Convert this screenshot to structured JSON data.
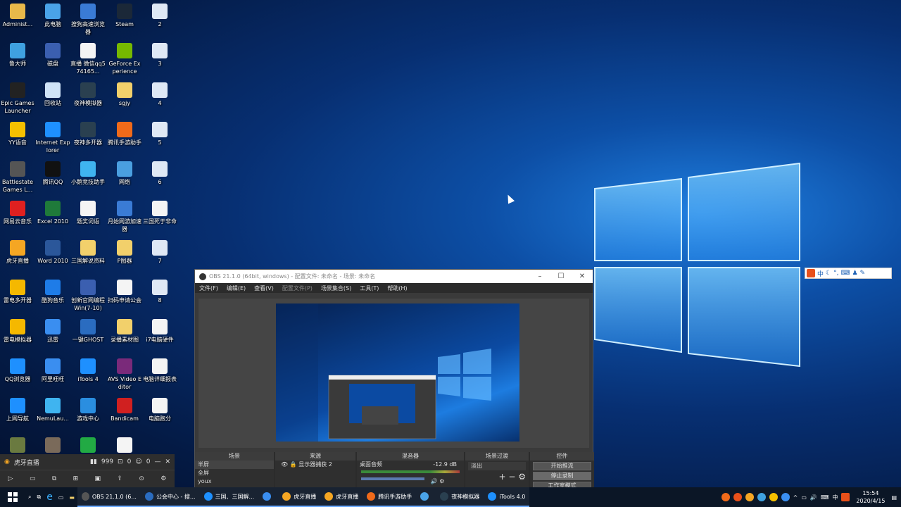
{
  "desktop_icons": [
    {
      "label": "Administ...",
      "icon": "user-folder-icon",
      "color": "#e8b84a"
    },
    {
      "label": "此电脑",
      "icon": "computer-icon",
      "color": "#4aa3e8"
    },
    {
      "label": "搜狗高速浏览器",
      "icon": "sogou-browser-icon",
      "color": "#3a7bd5"
    },
    {
      "label": "Steam",
      "icon": "steam-icon",
      "color": "#1b2838"
    },
    {
      "label": "2",
      "icon": "word-doc-icon",
      "color": "#dfe8f5"
    },
    {
      "label": "鲁大师",
      "icon": "ludashi-icon",
      "color": "#3fa1e0"
    },
    {
      "label": "磁盘",
      "icon": "disk-tool-icon",
      "color": "#3b5fb0"
    },
    {
      "label": "直播 微信qq574165...",
      "icon": "text-file-icon",
      "color": "#f4f4f4"
    },
    {
      "label": "GeForce Experience",
      "icon": "nvidia-icon",
      "color": "#76b900"
    },
    {
      "label": "3",
      "icon": "word-doc-icon",
      "color": "#dfe8f5"
    },
    {
      "label": "Epic Games Launcher",
      "icon": "epic-games-icon",
      "color": "#222222"
    },
    {
      "label": "回收站",
      "icon": "recycle-bin-icon",
      "color": "#cfe3f7"
    },
    {
      "label": "夜神模拟器",
      "icon": "nox-icon",
      "color": "#2a4050"
    },
    {
      "label": "sgjy",
      "icon": "folder-icon",
      "color": "#f2d06b"
    },
    {
      "label": "4",
      "icon": "word-doc-icon",
      "color": "#dfe8f5"
    },
    {
      "label": "YY语音",
      "icon": "yy-icon",
      "color": "#f5c000"
    },
    {
      "label": "Internet Explorer",
      "icon": "ie-icon",
      "color": "#1e90ff"
    },
    {
      "label": "夜神多开器",
      "icon": "nox-multi-icon",
      "color": "#2a4050"
    },
    {
      "label": "腾讯手游助手",
      "icon": "tencent-gamer-icon",
      "color": "#f06a1a"
    },
    {
      "label": "5",
      "icon": "word-doc-icon",
      "color": "#dfe8f5"
    },
    {
      "label": "Battlestate Games L...",
      "icon": "battlestate-icon",
      "color": "#555555"
    },
    {
      "label": "腾讯QQ",
      "icon": "qq-icon",
      "color": "#111111"
    },
    {
      "label": "小鹅竞技助手",
      "icon": "goose-icon",
      "color": "#3fb4f0"
    },
    {
      "label": "网络",
      "icon": "network-icon",
      "color": "#4a9fe0"
    },
    {
      "label": "6",
      "icon": "word-doc-icon",
      "color": "#dfe8f5"
    },
    {
      "label": "网易云音乐",
      "icon": "netease-music-icon",
      "color": "#e02020"
    },
    {
      "label": "Excel 2010",
      "icon": "excel-icon",
      "color": "#1f7a3a"
    },
    {
      "label": "题奖词语",
      "icon": "text-file-icon",
      "color": "#f4f4f4"
    },
    {
      "label": "月始网游加速器",
      "icon": "accelerator-icon",
      "color": "#3a7bd5"
    },
    {
      "label": "三国死于非命",
      "icon": "text-file-icon",
      "color": "#f4f4f4"
    },
    {
      "label": "虎牙直播",
      "icon": "huya-icon",
      "color": "#f5a623"
    },
    {
      "label": "Word 2010",
      "icon": "word-icon",
      "color": "#2b579a"
    },
    {
      "label": "三国解说资料",
      "icon": "folder-icon",
      "color": "#f2d06b"
    },
    {
      "label": "P图器",
      "icon": "folder-icon",
      "color": "#f2d06b"
    },
    {
      "label": "7",
      "icon": "word-doc-icon",
      "color": "#dfe8f5"
    },
    {
      "label": "雷电多开器",
      "icon": "ldplayer-multi-icon",
      "color": "#f5b800"
    },
    {
      "label": "酷狗音乐",
      "icon": "kugou-icon",
      "color": "#1e7ce8"
    },
    {
      "label": "创新官网编程Win(7-10)",
      "icon": "creative-icon",
      "color": "#3b5fb0"
    },
    {
      "label": "扫码申请公会",
      "icon": "text-file-icon",
      "color": "#f4f4f4"
    },
    {
      "label": "8",
      "icon": "word-doc-icon",
      "color": "#dfe8f5"
    },
    {
      "label": "雷电模拟器",
      "icon": "ldplayer-icon",
      "color": "#f5b800"
    },
    {
      "label": "迅雷",
      "icon": "xunlei-icon",
      "color": "#3a8ef0"
    },
    {
      "label": "一键GHOST",
      "icon": "ghost-icon",
      "color": "#2a6cc0"
    },
    {
      "label": "录播素材图",
      "icon": "folder-icon",
      "color": "#f2d06b"
    },
    {
      "label": "i7电脑硬件",
      "icon": "text-file-icon",
      "color": "#f4f4f4"
    },
    {
      "label": "QQ浏览器",
      "icon": "qq-browser-icon",
      "color": "#1e90ff"
    },
    {
      "label": "阿里旺旺",
      "icon": "wangwang-icon",
      "color": "#3a8ef0"
    },
    {
      "label": "iTools 4",
      "icon": "itools-icon",
      "color": "#1e90ff"
    },
    {
      "label": "AVS Video Editor",
      "icon": "avs-icon",
      "color": "#7a2a7a"
    },
    {
      "label": "电脑详细报表",
      "icon": "text-file-icon",
      "color": "#f4f4f4"
    },
    {
      "label": "上网导航",
      "icon": "ie-nav-icon",
      "color": "#1e90ff"
    },
    {
      "label": "NemuLau...",
      "icon": "mumu-icon",
      "color": "#3fb4f0"
    },
    {
      "label": "游戏中心",
      "icon": "game-center-icon",
      "color": "#2a8ee0"
    },
    {
      "label": "Bandicam",
      "icon": "bandicam-icon",
      "color": "#d02020"
    },
    {
      "label": "电脑跑分",
      "icon": "text-file-icon",
      "color": "#f4f4f4"
    },
    {
      "label": "",
      "icon": "game-icon",
      "color": "#6a7a40"
    },
    {
      "label": "dwrg (3)",
      "icon": "game-icon",
      "color": "#7a6a5a"
    },
    {
      "label": "迅雷影音...",
      "icon": "green-ball-icon",
      "color": "#22aa44"
    },
    {
      "label": "",
      "icon": "text-file-icon",
      "color": "#f4f4f4"
    }
  ],
  "obs": {
    "title": "OBS 21.1.0 (64bit, windows) - 配置文件: 未命名 - 场景: 未命名",
    "menu": [
      "文件(F)",
      "编辑(E)",
      "查看(V)",
      "配置文件(P)",
      "场景集合(S)",
      "工具(T)",
      "帮助(H)"
    ],
    "docks": {
      "scenes": {
        "header": "场景",
        "items": [
          "半屏",
          "全屏",
          "youx"
        ]
      },
      "sources": {
        "header": "来源",
        "items": [
          "显示器捕获 2"
        ]
      },
      "mixer": {
        "header": "混音器",
        "track": "桌面音频",
        "level": "-12.9 dB"
      },
      "transitions": {
        "header": "场景过渡",
        "value": "淡出"
      },
      "controls": {
        "header": "控件",
        "start_stream": "开始推流",
        "stop_record": "停止录制",
        "studio": "工作室模式"
      }
    }
  },
  "widget": {
    "title": "虎牙直播",
    "viewers": "999",
    "likes": "0",
    "fans": "0"
  },
  "taskbar": {
    "tasks": [
      "OBS 21.1.0 (6...",
      "公会中心 - 搜...",
      "三国、三国解...",
      "",
      "虎牙直播",
      "虎牙直播",
      "腾讯手游助手",
      "",
      "夜神模拟器",
      "iTools 4.0"
    ],
    "ime": "中",
    "time": "15:54",
    "date": "2020/4/15"
  },
  "ime_bar": {
    "label": "中"
  }
}
